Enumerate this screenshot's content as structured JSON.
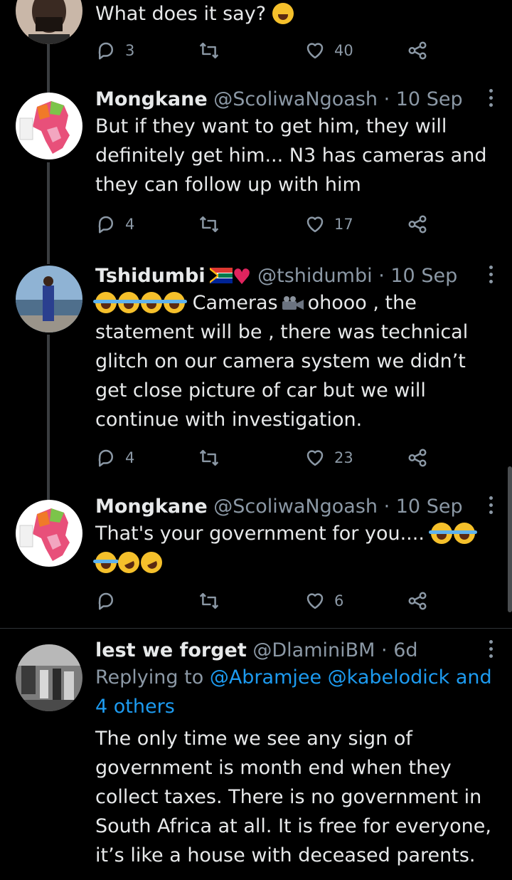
{
  "tweets": [
    {
      "text": "What does it say?",
      "emoji": "upside-down-face",
      "replies": "3",
      "retweets": "",
      "likes": "40"
    },
    {
      "name": "Mongkane",
      "handle": "@ScoliwaNgoash",
      "time": "10 Sep",
      "text": "But if they want to get him, they will definitely get him... N3 has cameras and they can follow up with him",
      "replies": "4",
      "retweets": "",
      "likes": "17"
    },
    {
      "name": "Tshidumbi",
      "handle": "@tshidumbi",
      "time": "10 Sep",
      "text_a": "Cameras",
      "text_b": "ohooo , the statement will be , there was technical glitch on our camera system we didn’t get close picture of car but we will continue with investigation.",
      "replies": "4",
      "retweets": "",
      "likes": "23"
    },
    {
      "name": "Mongkane",
      "handle": "@ScoliwaNgoash",
      "time": "10 Sep",
      "text": "That's your government for you....",
      "replies": "",
      "retweets": "",
      "likes": "6"
    },
    {
      "name": "lest we forget",
      "handle": "@DlaminiBM",
      "time": "6d",
      "replying_prefix": "Replying to",
      "replying_mentions": "@Abramjee @kabelodick and 4 others",
      "text": "The only time we see any sign of government is month end when they collect taxes. There is no government in South Africa at all. It is free for everyone, it’s like a house with deceased parents."
    }
  ],
  "separator": " · ",
  "icons": {
    "reply": "reply-icon",
    "retweet": "retweet-icon",
    "like": "heart-icon",
    "share": "share-icon",
    "more": "more-icon"
  },
  "colors": {
    "background": "#000000",
    "text": "#e7e9ea",
    "secondary": "#8b98a5",
    "link": "#1d9bf0",
    "divider": "#2f3336"
  }
}
